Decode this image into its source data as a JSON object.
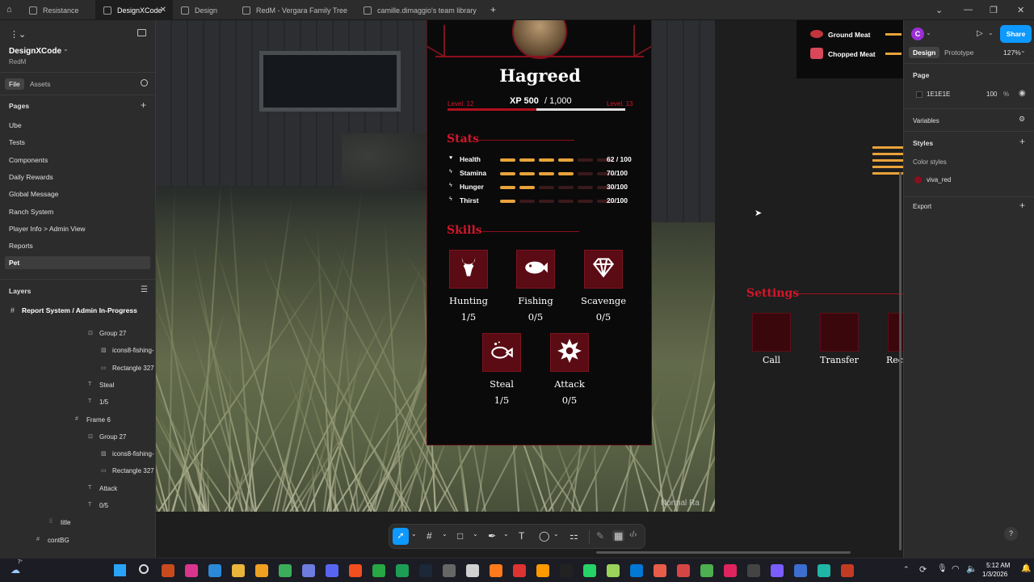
{
  "tabs": [
    {
      "label": "Resistance",
      "active": false
    },
    {
      "label": "DesignXCode",
      "active": true
    },
    {
      "label": "Design",
      "active": false
    },
    {
      "label": "RedM - Vergara Family Tree",
      "active": false
    },
    {
      "label": "camille.dimaggio's team library",
      "active": false
    }
  ],
  "sidebar": {
    "file_name": "DesignXCode",
    "project": "RedM",
    "tab_file": "File",
    "tab_assets": "Assets",
    "pages_title": "Pages",
    "pages": [
      "Ube",
      "Tests",
      "Components",
      "Daily Rewards",
      "Global Message",
      "Ranch System",
      "Player Info > Admin View",
      "Reports",
      "Pet"
    ],
    "layers_title": "Layers",
    "layers_root": "Report System / Admin In-Progress",
    "layers": [
      {
        "label": "Group 27",
        "icon": "group-icon"
      },
      {
        "label": "icons8-fishing-",
        "icon": "image-icon"
      },
      {
        "label": "Rectangle 327",
        "icon": "rectangle-icon"
      },
      {
        "label": "Steal",
        "icon": "text-icon"
      },
      {
        "label": "1/5",
        "icon": "text-icon"
      },
      {
        "label": "Frame 6",
        "icon": "frame-icon"
      },
      {
        "label": "Group 27",
        "icon": "group-icon"
      },
      {
        "label": "icons8-fishing-",
        "icon": "image-icon"
      },
      {
        "label": "Rectangle 327",
        "icon": "rectangle-icon"
      },
      {
        "label": "Attack",
        "icon": "text-icon"
      },
      {
        "label": "0/5",
        "icon": "text-icon"
      },
      {
        "label": "title",
        "icon": "component-icon"
      },
      {
        "label": "contBG",
        "icon": "frame-icon"
      }
    ]
  },
  "card": {
    "name": "Hagreed",
    "level_left": "Level. 12",
    "level_right": "Level. 13",
    "xp": "XP 500",
    "xp_total": "/ 1,000",
    "xp_progress": 0.5,
    "stats_title": "Stats",
    "stats": [
      {
        "label": "Health",
        "value": "62 / 100",
        "fraction": 0.62
      },
      {
        "label": "Stamina",
        "value": "70/100",
        "fraction": 0.7
      },
      {
        "label": "Hunger",
        "value": "30/100",
        "fraction": 0.3
      },
      {
        "label": "Thirst",
        "value": "20/100",
        "fraction": 0.2
      }
    ],
    "skills_title": "Skills",
    "skills": [
      {
        "label": "Hunting",
        "value": "1/5",
        "icon": "deer-icon"
      },
      {
        "label": "Fishing",
        "value": "0/5",
        "icon": "fish-icon"
      },
      {
        "label": "Scavenge",
        "value": "0/5",
        "icon": "diamond-icon"
      },
      {
        "label": "Steal",
        "value": "1/5",
        "icon": "fish-steal-icon"
      },
      {
        "label": "Attack",
        "value": "0/5",
        "icon": "burst-icon"
      }
    ]
  },
  "settings": {
    "title": "Settings",
    "items": [
      "Call",
      "Transfer",
      "Rec"
    ]
  },
  "inventory": [
    "Ground Meat",
    "Chopped Meat"
  ],
  "watermark": "Normal Ra",
  "right_panel": {
    "avatar_letter": "C",
    "share": "Share",
    "tab_design": "Design",
    "tab_prototype": "Prototype",
    "zoom": "127%",
    "page_title": "Page",
    "page_color": "1E1E1E",
    "page_opacity": "100",
    "percent": "%",
    "variables": "Variables",
    "styles": "Styles",
    "color_styles": "Color styles",
    "style_name": "viva_red",
    "export": "Export"
  },
  "taskbar": {
    "time": "5:12 AM",
    "date": "1/3/2026",
    "weather_badge": "7°"
  },
  "colors": {
    "accent_red": "#d4162a",
    "bar_orange": "#e8a33a",
    "bar_empty": "#3a1a1c",
    "figma_blue": "#0d99ff"
  }
}
